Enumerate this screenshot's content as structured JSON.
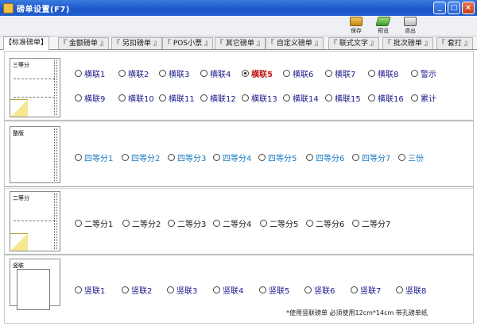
{
  "window": {
    "title": "磅单设置(F7)",
    "controls": {
      "minimize": "_",
      "maximize": "□",
      "close": "×"
    }
  },
  "toolbar": {
    "save": {
      "label": "保存",
      "icon": "save-icon"
    },
    "preview": {
      "label": "预览",
      "icon": "preview-icon"
    },
    "exit": {
      "label": "退出",
      "icon": "exit-icon"
    }
  },
  "tabs": [
    {
      "label": "【标准磅单】",
      "active": true
    },
    {
      "label": "『 金额磅单 』",
      "active": false
    },
    {
      "label": "『 另扣磅单 』",
      "active": false
    },
    {
      "label": "『 POS小票 』",
      "active": false
    },
    {
      "label": "『 其它磅单 』",
      "active": false
    },
    {
      "label": "『 自定义磅单 』",
      "active": false
    },
    {
      "label": "『 联式文字 』",
      "active": false
    },
    {
      "label": "『 批次磅单 』",
      "active": false
    },
    {
      "label": "『 套打 』",
      "active": false
    }
  ],
  "sections": {
    "s1": {
      "thumb_label": "三等分",
      "row1": [
        "横联1",
        "横联2",
        "横联3",
        "横联4",
        "横联5",
        "横联6",
        "横联7",
        "横联8",
        "警示"
      ],
      "row2": [
        "横联9",
        "横联10",
        "横联11",
        "横联12",
        "横联13",
        "横联14",
        "横联15",
        "横联16",
        "累计"
      ],
      "selected": "横联5"
    },
    "s2": {
      "thumb_label": "整版",
      "options": [
        "四等分1",
        "四等分2",
        "四等分3",
        "四等分4",
        "四等分5",
        "四等分6",
        "四等分7",
        "三份"
      ]
    },
    "s3": {
      "thumb_label": "二等分",
      "options": [
        "二等分1",
        "二等分2",
        "二等分3",
        "二等分4",
        "二等分5",
        "二等分6",
        "二等分7"
      ]
    },
    "s4": {
      "thumb_label": "竖联",
      "options": [
        "竖联1",
        "竖联2",
        "竖联3",
        "竖联4",
        "竖联5",
        "竖联6",
        "竖联7",
        "竖联8"
      ]
    }
  },
  "note": "*使用竖联磅单   必须使用12cm*14cm 带孔磅单纸",
  "colors": {
    "titlebar": "#1b55c8",
    "label_navy": "#1a1a8a",
    "label_blue": "#1a7ac0",
    "selected_red": "#c01818"
  }
}
